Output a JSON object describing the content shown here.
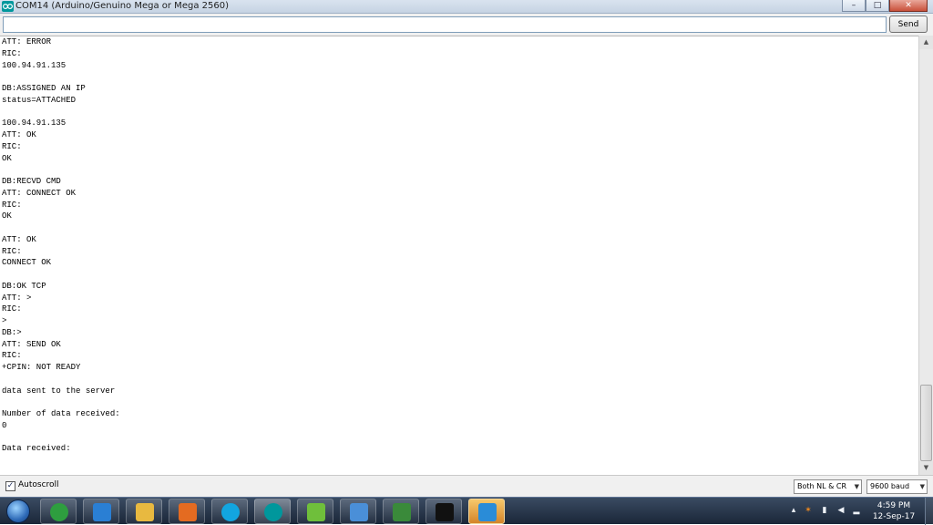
{
  "window": {
    "title": "COM14 (Arduino/Genuino Mega or Mega 2560)",
    "controls": {
      "minimize": "–",
      "maximize": "□",
      "close": "✕"
    }
  },
  "send_bar": {
    "input_value": "",
    "send_label": "Send"
  },
  "console_lines": [
    "ATT: ERROR",
    "RIC:",
    "100.94.91.135",
    "",
    "DB:ASSIGNED AN IP",
    "status=ATTACHED",
    "",
    "100.94.91.135",
    "ATT: OK",
    "RIC:",
    "OK",
    "",
    "DB:RECVD CMD",
    "ATT: CONNECT OK",
    "RIC:",
    "OK",
    "",
    "ATT: OK",
    "RIC:",
    "CONNECT OK",
    "",
    "DB:OK TCP",
    "ATT: >",
    "RIC:",
    ">",
    "DB:>",
    "ATT: SEND OK",
    "RIC:",
    "+CPIN: NOT READY",
    "",
    "data sent to the server",
    "",
    "Number of data received:",
    "0",
    "",
    "Data received:"
  ],
  "status_bar": {
    "autoscroll_label": "Autoscroll",
    "autoscroll_checked": true,
    "line_ending": "Both NL & CR",
    "baud_rate": "9600 baud"
  },
  "taskbar": {
    "apps": [
      {
        "icon": "chrome-icon",
        "color": "#2e9e3f"
      },
      {
        "icon": "internet-explorer-icon",
        "color": "#2a7fd4"
      },
      {
        "icon": "file-explorer-icon",
        "color": "#e8b940"
      },
      {
        "icon": "media-player-icon",
        "color": "#e46b21"
      },
      {
        "icon": "skype-icon",
        "color": "#12a5e0"
      },
      {
        "icon": "arduino-icon",
        "color": "#00979c"
      },
      {
        "icon": "notepad-icon",
        "color": "#6fbf3b"
      },
      {
        "icon": "paint-icon",
        "color": "#4a8fd8"
      },
      {
        "icon": "network-tool-icon",
        "color": "#3a8a3a"
      },
      {
        "icon": "command-prompt-icon",
        "color": "#111111"
      },
      {
        "icon": "settings-app-icon",
        "color": "#2a8cd8"
      }
    ],
    "tray": {
      "icons": [
        "avast-icon",
        "usb-device-icon",
        "volume-icon",
        "network-signal-icon"
      ],
      "time": "4:59 PM",
      "date": "12-Sep-17"
    }
  },
  "colors": {
    "taskbar_accent": "#d4842a",
    "window_title_bar": "#c6d3e3"
  }
}
